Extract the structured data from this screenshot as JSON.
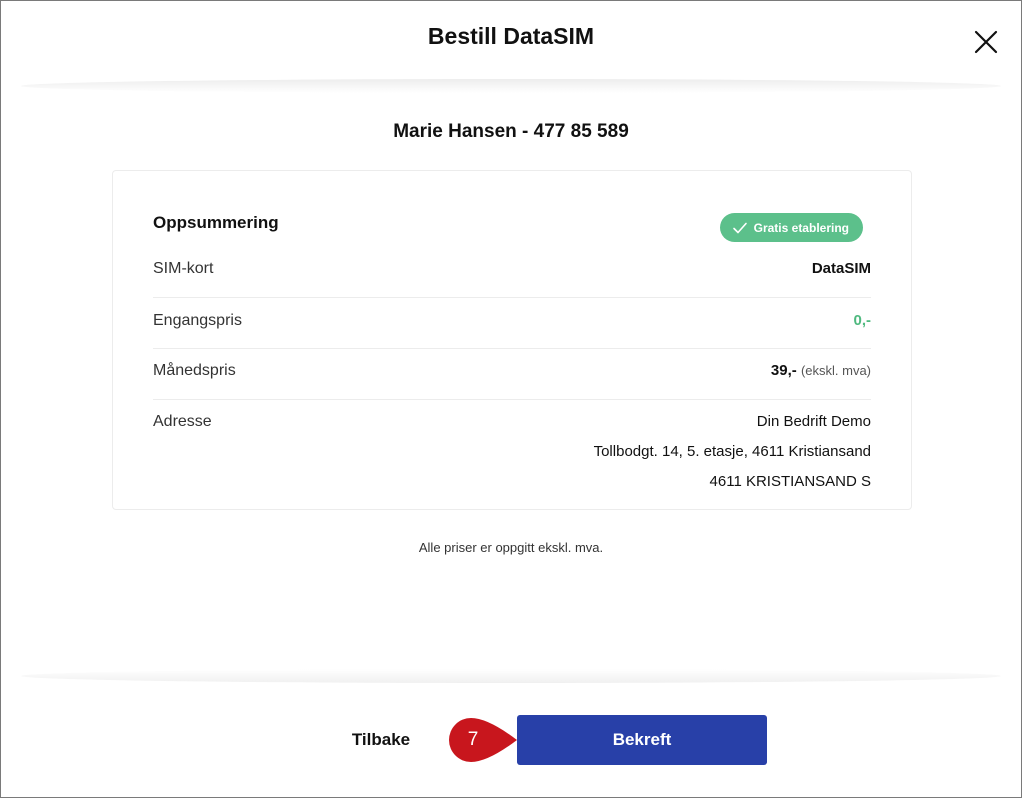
{
  "modal": {
    "title": "Bestill DataSIM",
    "close_icon": "close-icon"
  },
  "subscriber": "Marie Hansen - 477 85 589",
  "summary": {
    "title": "Oppsummering",
    "badge": "Gratis etablering",
    "rows": [
      {
        "label": "SIM-kort",
        "value": "DataSIM"
      },
      {
        "label": "Engangspris",
        "value": "0,-"
      },
      {
        "label": "Månedspris",
        "value": "39,-",
        "suffix": "(ekskl. mva)"
      },
      {
        "label": "Adresse",
        "lines": [
          "Din Bedrift Demo",
          "Tollbodgt. 14, 5. etasje, 4611 Kristiansand",
          "4611 KRISTIANSAND S"
        ]
      }
    ]
  },
  "note": "Alle priser er oppgitt ekskl. mva.",
  "footer": {
    "back_label": "Tilbake",
    "confirm_label": "Bekreft",
    "step_marker": "7"
  },
  "colors": {
    "primary": "#2840a8",
    "success": "#5cc08b",
    "marker": "#c8161d"
  }
}
